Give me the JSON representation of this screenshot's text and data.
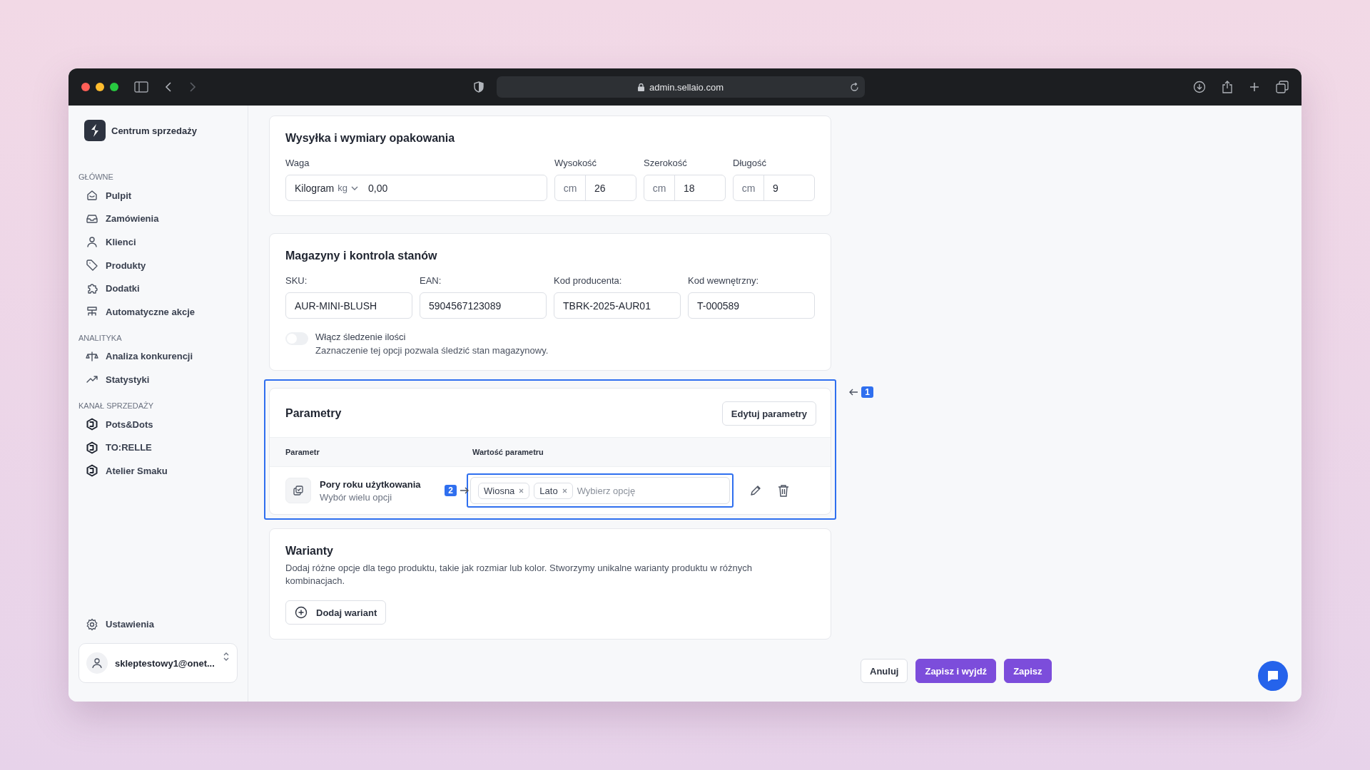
{
  "browser": {
    "url": "admin.sellaio.com"
  },
  "sidebar": {
    "brand": "Centrum sprzedaży",
    "sections": [
      {
        "title": "GŁÓWNE",
        "items": [
          {
            "label": "Pulpit",
            "kind": "home"
          },
          {
            "label": "Zamówienia",
            "kind": "inbox"
          },
          {
            "label": "Klienci",
            "kind": "user"
          },
          {
            "label": "Produkty",
            "kind": "tag"
          },
          {
            "label": "Dodatki",
            "kind": "puzzle"
          },
          {
            "label": "Automatyczne akcje",
            "kind": "flow"
          }
        ]
      },
      {
        "title": "ANALITYKA",
        "items": [
          {
            "label": "Analiza konkurencji",
            "kind": "scale"
          },
          {
            "label": "Statystyki",
            "kind": "trend"
          }
        ]
      },
      {
        "title": "KANAŁ SPRZEDAŻY",
        "items": [
          {
            "label": "Pots&Dots",
            "kind": "channel"
          },
          {
            "label": "TO:RELLE",
            "kind": "channel"
          },
          {
            "label": "Atelier Smaku",
            "kind": "channel"
          }
        ]
      }
    ],
    "settings": "Ustawienia",
    "account": "skleptestowy1@onet..."
  },
  "shipping": {
    "title": "Wysyłka i wymiary opakowania",
    "weight": {
      "label": "Waga",
      "unit_name": "Kilogram",
      "unit": "kg",
      "value": "0,00"
    },
    "dims": [
      {
        "label": "Wysokość",
        "unit": "cm",
        "value": "26"
      },
      {
        "label": "Szerokość",
        "unit": "cm",
        "value": "18"
      },
      {
        "label": "Długość",
        "unit": "cm",
        "value": "9"
      }
    ]
  },
  "inventory": {
    "title": "Magazyny i kontrola stanów",
    "fields": [
      {
        "label": "SKU:",
        "value": "AUR-MINI-BLUSH"
      },
      {
        "label": "EAN:",
        "value": "5904567123089"
      },
      {
        "label": "Kod producenta:",
        "value": "TBRK-2025-AUR01"
      },
      {
        "label": "Kod wewnętrzny:",
        "value": "T-000589"
      }
    ],
    "toggle": {
      "label": "Włącz śledzenie ilości",
      "hint": "Zaznaczenie tej opcji pozwala śledzić stan magazynowy.",
      "on": false
    }
  },
  "parameters": {
    "title": "Parametry",
    "edit_button": "Edytuj parametry",
    "callout": "1",
    "columns": [
      "Parametr",
      "Wartość parametru"
    ],
    "rows": [
      {
        "name": "Pory roku użytkowania",
        "type": "Wybór wielu opcji",
        "callout": "2",
        "tags": [
          "Wiosna",
          "Lato"
        ],
        "placeholder": "Wybierz opcję"
      }
    ]
  },
  "variants": {
    "title": "Warianty",
    "description": "Dodaj różne opcje dla tego produktu, takie jak rozmiar lub kolor. Stworzymy unikalne warianty produktu w różnych kombinacjach.",
    "add_button": "Dodaj wariant"
  },
  "actions": [
    {
      "label": "Anuluj",
      "kind": "secondary"
    },
    {
      "label": "Zapisz i wyjdź",
      "kind": "primary"
    },
    {
      "label": "Zapisz",
      "kind": "primary"
    }
  ]
}
